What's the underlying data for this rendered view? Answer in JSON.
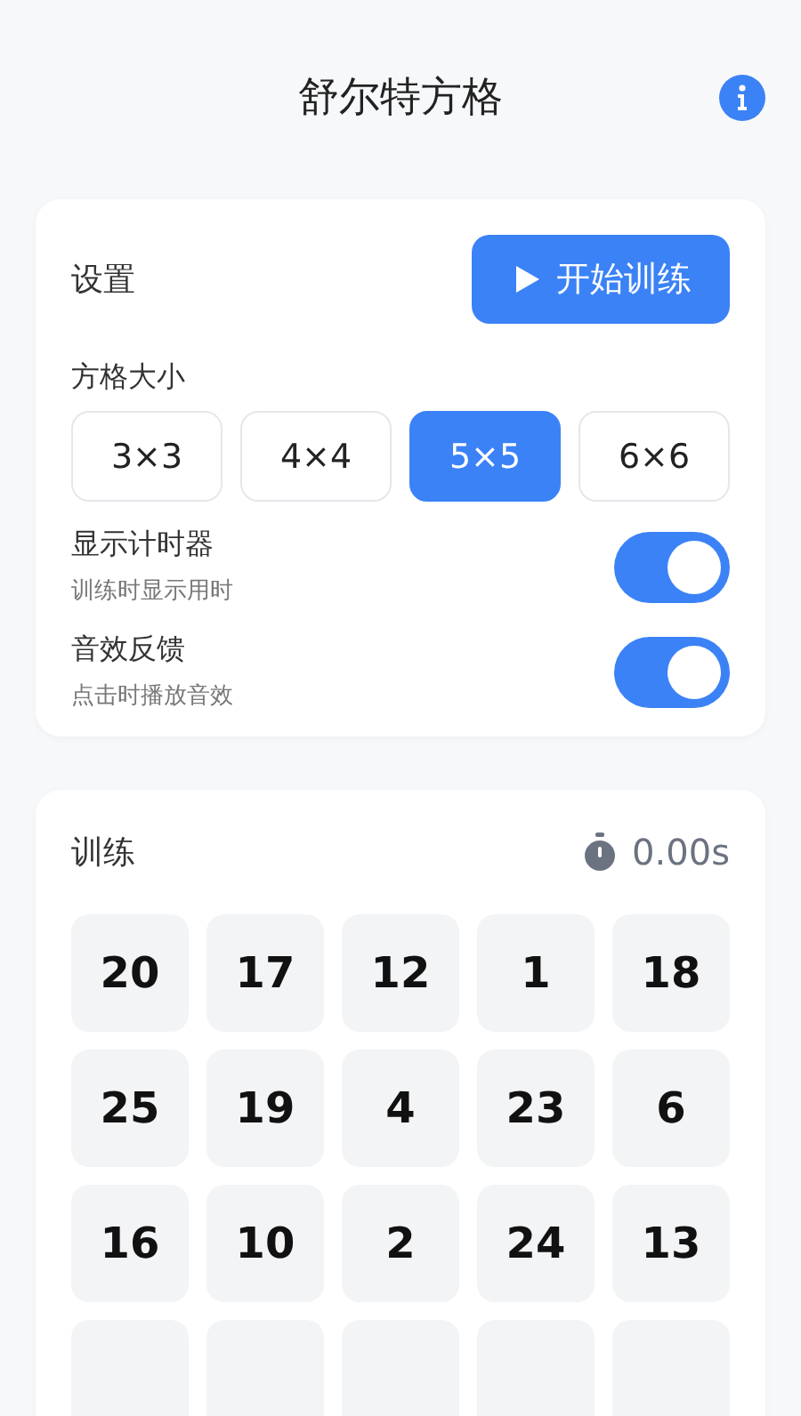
{
  "header": {
    "title": "舒尔特方格"
  },
  "settings": {
    "title": "设置",
    "start_button": "开始训练",
    "size_label": "方格大小",
    "sizes": [
      {
        "label": "3×3",
        "selected": false
      },
      {
        "label": "4×4",
        "selected": false
      },
      {
        "label": "5×5",
        "selected": true
      },
      {
        "label": "6×6",
        "selected": false
      }
    ],
    "toggles": [
      {
        "label": "显示计时器",
        "description": "训练时显示用时",
        "on": true
      },
      {
        "label": "音效反馈",
        "description": "点击时播放音效",
        "on": true
      }
    ]
  },
  "training": {
    "title": "训练",
    "timer": "0.00s",
    "grid": [
      [
        {
          "kind": "number",
          "number": "20"
        },
        {
          "kind": "number",
          "number": "17"
        },
        {
          "kind": "number",
          "number": "12"
        },
        {
          "kind": "number",
          "number": "1"
        },
        {
          "kind": "number",
          "number": "18"
        }
      ],
      [
        {
          "kind": "number",
          "number": "25"
        },
        {
          "kind": "number",
          "number": "19"
        },
        {
          "kind": "number",
          "number": "4"
        },
        {
          "kind": "number",
          "number": "23"
        },
        {
          "kind": "number",
          "number": "6"
        }
      ],
      [
        {
          "kind": "number",
          "number": "16"
        },
        {
          "kind": "number",
          "number": "10"
        },
        {
          "kind": "number",
          "number": "2"
        },
        {
          "kind": "number",
          "number": "24"
        },
        {
          "kind": "number",
          "number": "13"
        }
      ],
      [
        {
          "kind": "covered"
        },
        {
          "kind": "covered"
        },
        {
          "kind": "covered"
        },
        {
          "kind": "covered"
        },
        {
          "kind": "covered"
        }
      ]
    ]
  }
}
